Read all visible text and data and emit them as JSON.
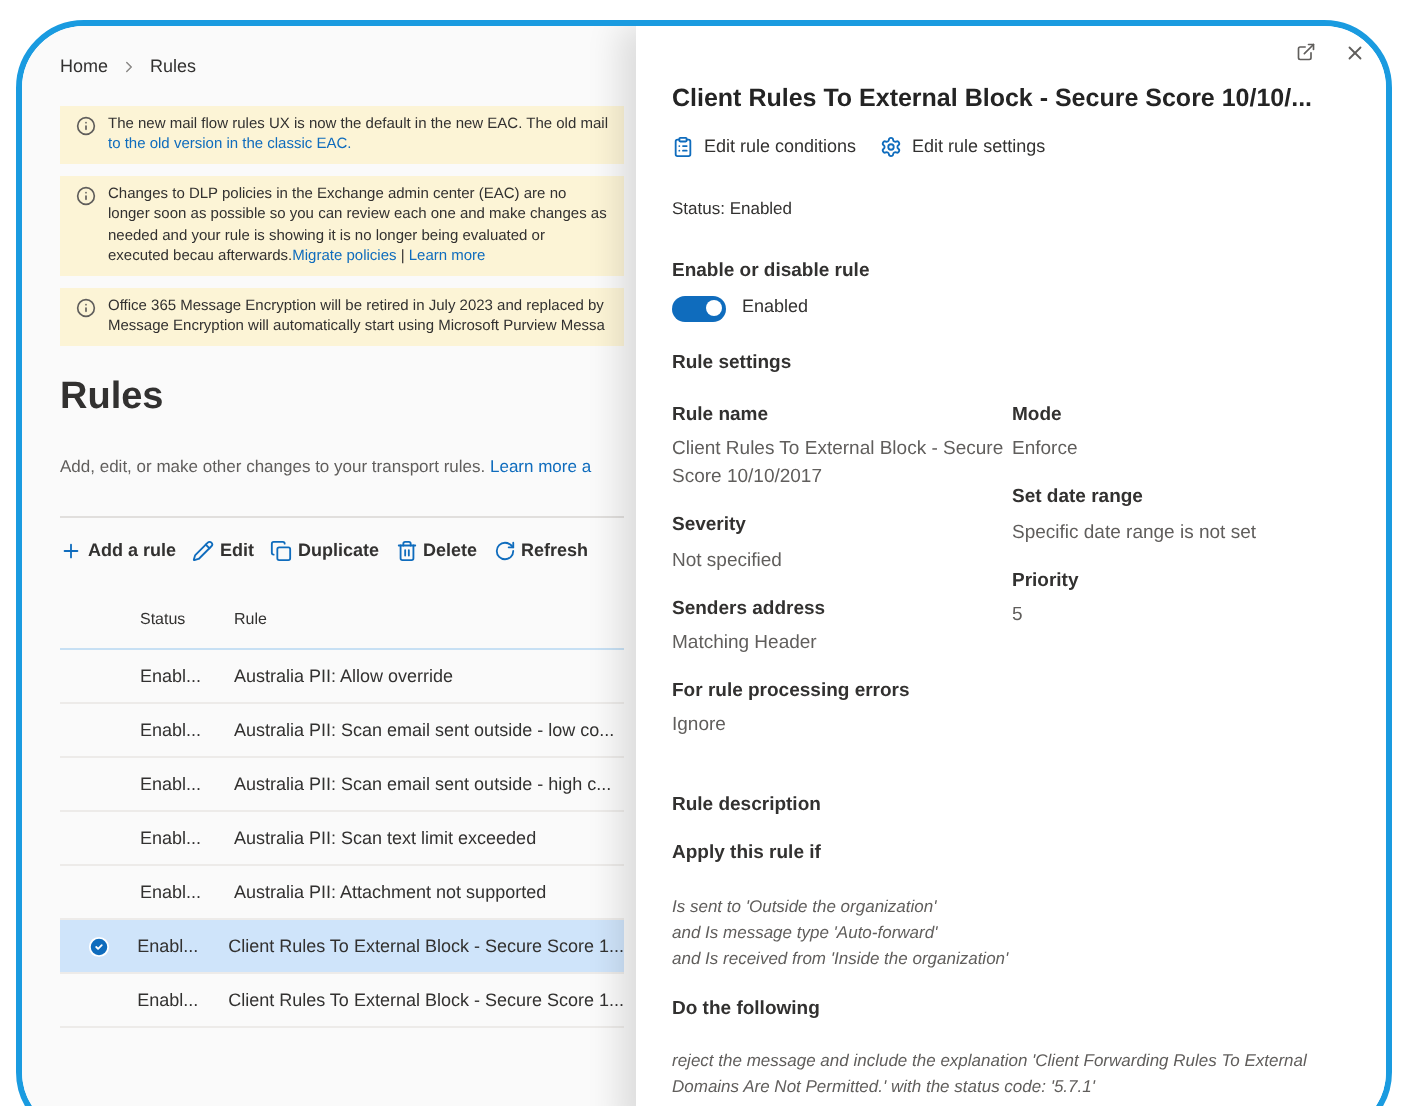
{
  "breadcrumb": [
    "Home",
    "Rules"
  ],
  "banners": [
    [
      {
        "text": "The new mail flow rules UX is now the default in the new EAC. The old mail ",
        "kind": "text"
      },
      {
        "text": "to the old version in the classic EAC.",
        "kind": "link"
      }
    ],
    [
      {
        "text": "Changes to DLP policies in the Exchange admin center (EAC) are no longer soon as possible so you can review each one and make changes as needed and your rule is showing it is no longer being evaluated or executed becau afterwards.",
        "kind": "text"
      },
      {
        "text": "Migrate policies",
        "kind": "link"
      },
      {
        "text": " | ",
        "kind": "text"
      },
      {
        "text": "Learn more",
        "kind": "link"
      }
    ],
    [
      {
        "text": "Office 365 Message Encryption will be retired in July 2023 and replaced by Message Encryption will automatically start using Microsoft Purview Messa",
        "kind": "text"
      }
    ]
  ],
  "page_title": "Rules",
  "description": {
    "text": "Add, edit, or make other changes to your transport rules. ",
    "link": "Learn more a"
  },
  "toolbar": [
    {
      "kind": "add",
      "label": "Add a rule"
    },
    {
      "kind": "edit",
      "label": "Edit"
    },
    {
      "kind": "duplicate",
      "label": "Duplicate"
    },
    {
      "kind": "delete",
      "label": "Delete"
    },
    {
      "kind": "refresh",
      "label": "Refresh"
    }
  ],
  "table": {
    "columns": [
      "Status",
      "Rule"
    ],
    "rows": [
      {
        "status": "Enabl...",
        "rule": "Australia PII: Allow override",
        "selected": false
      },
      {
        "status": "Enabl...",
        "rule": "Australia PII: Scan email sent outside - low co...",
        "selected": false
      },
      {
        "status": "Enabl...",
        "rule": "Australia PII: Scan email sent outside - high c...",
        "selected": false
      },
      {
        "status": "Enabl...",
        "rule": "Australia PII: Scan text limit exceeded",
        "selected": false
      },
      {
        "status": "Enabl...",
        "rule": "Australia PII: Attachment not supported",
        "selected": false
      },
      {
        "status": "Enabl...",
        "rule": "Client Rules To External Block - Secure Score 1...",
        "selected": true
      },
      {
        "status": "Enabl...",
        "rule": "Client Rules To External Block - Secure Score 1...",
        "selected": false
      }
    ]
  },
  "panel": {
    "title": "Client Rules To External Block - Secure Score 10/10/...",
    "actions": [
      {
        "kind": "conditions",
        "label": "Edit rule conditions"
      },
      {
        "kind": "settings",
        "label": "Edit rule settings"
      }
    ],
    "status": "Status: Enabled",
    "toggle": {
      "label": "Enable or disable rule",
      "on": true,
      "state_text": "Enabled"
    },
    "settings_heading": "Rule settings",
    "settings_left": [
      {
        "label": "Rule name",
        "value": "Client Rules To External Block - Secure Score 10/10/2017"
      },
      {
        "label": "Severity",
        "value": "Not specified"
      },
      {
        "label": "Senders address",
        "value": "Matching Header"
      },
      {
        "label": "For rule processing errors",
        "value": "Ignore"
      }
    ],
    "settings_right": [
      {
        "label": "Mode",
        "value": "Enforce"
      },
      {
        "label": "Set date range",
        "value": "Specific date range is not set"
      },
      {
        "label": "Priority",
        "value": "5"
      }
    ],
    "description_heading": "Rule description",
    "apply_heading": "Apply this rule if",
    "conditions": [
      "Is sent to 'Outside the organization'",
      "and Is message type 'Auto-forward'",
      "and Is received from 'Inside the organization'"
    ],
    "do_heading": "Do the following",
    "action_text": "reject the message and include the explanation 'Client Forwarding Rules To External Domains Are Not Permitted.' with the status code: '5.7.1'"
  }
}
